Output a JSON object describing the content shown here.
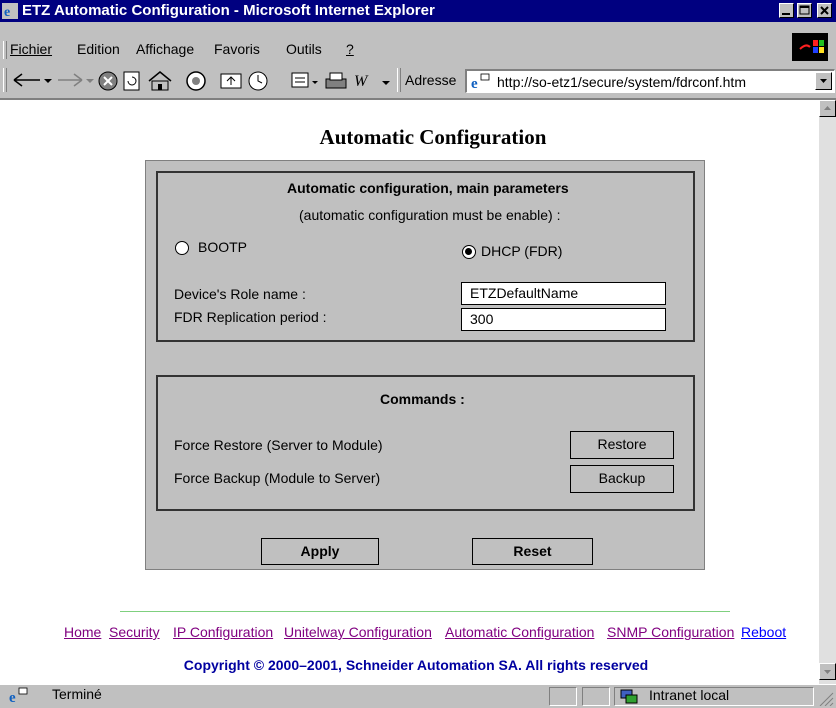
{
  "window": {
    "title": "ETZ  Automatic Configuration - Microsoft Internet Explorer"
  },
  "menu": {
    "items": [
      "Fichier",
      "Edition",
      "Affichage",
      "Favoris",
      "Outils",
      "?"
    ]
  },
  "toolbar": {
    "address_label": "Adresse",
    "url": "http://so-etz1/secure/system/fdrconf.htm"
  },
  "page": {
    "title": "Automatic Configuration",
    "main_params": {
      "heading": "Automatic configuration, main parameters",
      "subheading": "(automatic configuration must be enable) :",
      "radio_bootp_label": "BOOTP",
      "radio_dhcp_label": "DHCP (FDR)",
      "selected": "DHCP (FDR)",
      "role_name_label": "Device's Role name :",
      "role_name_value": "ETZDefaultName",
      "replication_label": "FDR Replication period :",
      "replication_value": "300"
    },
    "commands": {
      "heading": "Commands :",
      "restore_label": "Force Restore (Server to Module)",
      "restore_button": "Restore",
      "backup_label": "Force Backup (Module to Server)",
      "backup_button": "Backup"
    },
    "apply_button": "Apply",
    "reset_button": "Reset",
    "nav_links": [
      "Home",
      "Security",
      "IP Configuration",
      "Unitelway Configuration",
      "Automatic Configuration",
      "SNMP Configuration",
      "Reboot"
    ],
    "copyright": "Copyright © 2000–2001, Schneider Automation SA. All rights reserved"
  },
  "statusbar": {
    "status": "Terminé",
    "zone": "Intranet local"
  },
  "colors": {
    "titlebar": "#000080",
    "chrome": "#c0c0c0",
    "visited_link": "#800080",
    "link": "#0000ff",
    "copyright": "#0000a0"
  }
}
